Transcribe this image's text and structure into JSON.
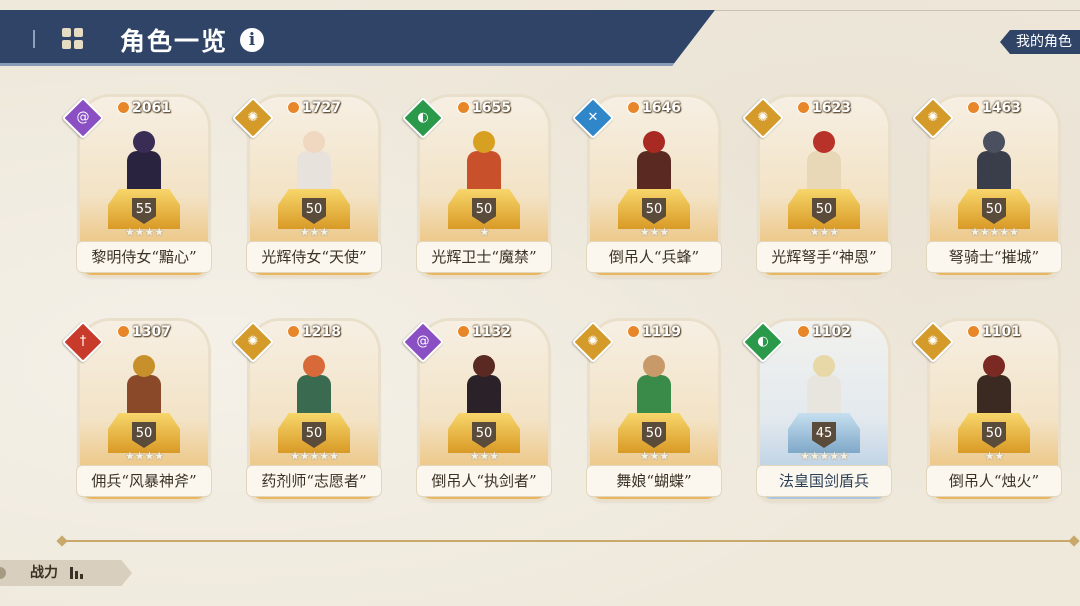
{
  "header": {
    "title": "角色一览",
    "my_characters": "我的角色"
  },
  "sort": {
    "label": "战力"
  },
  "colors": {
    "header_bg": "#2f4467",
    "gold": "#e9b65f",
    "blue": "#a9c6e0"
  },
  "cards": [
    {
      "name": "黎明侍女“黯心”",
      "power": "2061",
      "level": "55",
      "stars": "★★★★",
      "element": "purple",
      "element_color": "#8b4fc4",
      "element_icon": "swirl-icon",
      "element_glyph": "@",
      "head": "#3a2d55",
      "body": "#2a2340",
      "theme": "gold"
    },
    {
      "name": "光辉侍女“天使”",
      "power": "1727",
      "level": "50",
      "stars": "★★★",
      "element": "gold",
      "element_color": "#d49a2a",
      "element_icon": "sun-icon",
      "element_glyph": "✺",
      "head": "#f0d8c0",
      "body": "#e8e2dc",
      "theme": "gold"
    },
    {
      "name": "光辉卫士“魔禁”",
      "power": "1655",
      "level": "50",
      "stars": "★",
      "element": "green",
      "element_color": "#2a9a4a",
      "element_icon": "shield-icon",
      "element_glyph": "◐",
      "head": "#d8a020",
      "body": "#c8502a",
      "theme": "gold"
    },
    {
      "name": "倒吊人“兵蜂”",
      "power": "1646",
      "level": "50",
      "stars": "★★★",
      "element": "blue",
      "element_color": "#2f86c8",
      "element_icon": "arrows-icon",
      "element_glyph": "✕",
      "head": "#a82a22",
      "body": "#5a2a22",
      "theme": "gold"
    },
    {
      "name": "光辉弩手“神恩”",
      "power": "1623",
      "level": "50",
      "stars": "★★★",
      "element": "gold",
      "element_color": "#d49a2a",
      "element_icon": "sun-icon",
      "element_glyph": "✺",
      "head": "#b8322a",
      "body": "#e8d8b8",
      "theme": "gold"
    },
    {
      "name": "弩骑士“摧城”",
      "power": "1463",
      "level": "50",
      "stars": "★★★★★",
      "element": "gold",
      "element_color": "#d49a2a",
      "element_icon": "sun-icon",
      "element_glyph": "✺",
      "head": "#4a5060",
      "body": "#3a3e4a",
      "theme": "gold"
    },
    {
      "name": "佣兵“风暴神斧”",
      "power": "1307",
      "level": "50",
      "stars": "★★★★",
      "element": "red",
      "element_color": "#c83a2a",
      "element_icon": "sword-icon",
      "element_glyph": "†",
      "head": "#c8902a",
      "body": "#8a4a2a",
      "theme": "gold"
    },
    {
      "name": "药剂师“志愿者”",
      "power": "1218",
      "level": "50",
      "stars": "★★★★★",
      "element": "gold",
      "element_color": "#d49a2a",
      "element_icon": "sun-icon",
      "element_glyph": "✺",
      "head": "#d86a3a",
      "body": "#3a6a50",
      "theme": "gold"
    },
    {
      "name": "倒吊人“执剑者”",
      "power": "1132",
      "level": "50",
      "stars": "★★★",
      "element": "purple",
      "element_color": "#8b4fc4",
      "element_icon": "swirl-icon",
      "element_glyph": "@",
      "head": "#5a2a22",
      "body": "#2a2228",
      "theme": "gold"
    },
    {
      "name": "舞娘“蝴蝶”",
      "power": "1119",
      "level": "50",
      "stars": "★★★",
      "element": "gold",
      "element_color": "#d49a2a",
      "element_icon": "sun-icon",
      "element_glyph": "✺",
      "head": "#c89a6a",
      "body": "#3a8a4a",
      "theme": "gold"
    },
    {
      "name": "法皇国剑盾兵",
      "power": "1102",
      "level": "45",
      "stars": "★★★★★",
      "element": "green",
      "element_color": "#2a9a4a",
      "element_icon": "shield-icon",
      "element_glyph": "◐",
      "head": "#e8d8a8",
      "body": "#e8e4de",
      "theme": "blue"
    },
    {
      "name": "倒吊人“烛火”",
      "power": "1101",
      "level": "50",
      "stars": "★★",
      "element": "gold",
      "element_color": "#d49a2a",
      "element_icon": "sun-icon",
      "element_glyph": "✺",
      "head": "#7a2a22",
      "body": "#3a2a22",
      "theme": "gold"
    }
  ]
}
